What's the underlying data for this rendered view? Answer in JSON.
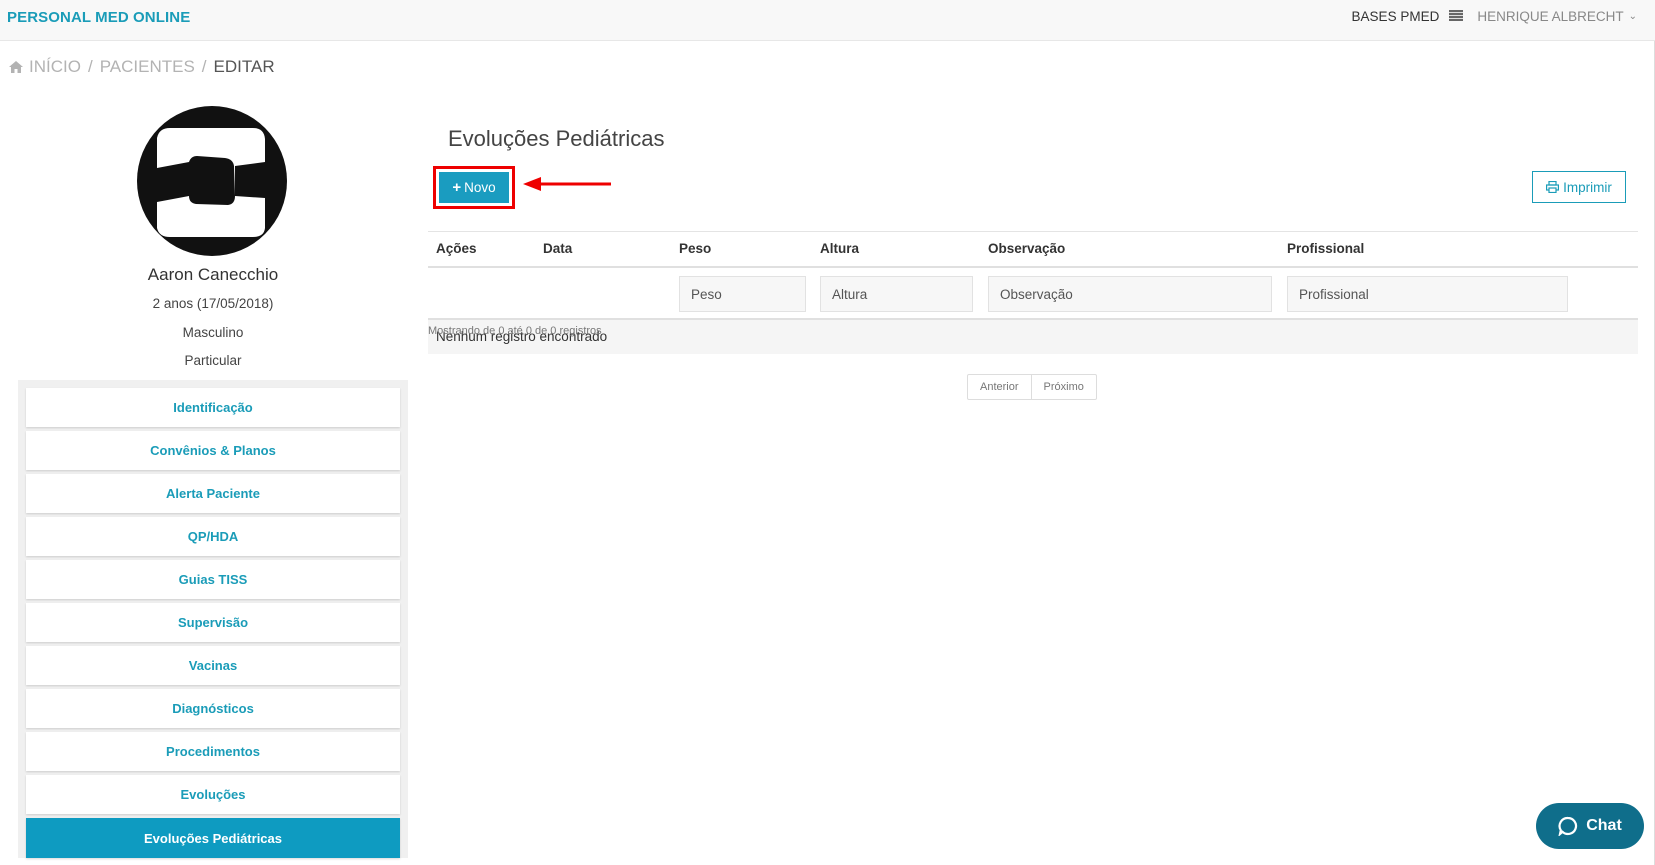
{
  "header": {
    "brand": "PERSONAL MED ONLINE",
    "bases": "BASES PMED",
    "user": "HENRIQUE ALBRECHT"
  },
  "breadcrumb": {
    "items": [
      "INÍCIO",
      "PACIENTES",
      "EDITAR"
    ]
  },
  "patient": {
    "name": "Aaron Canecchio",
    "age": "2 anos (17/05/2018)",
    "sex": "Masculino",
    "plan": "Particular"
  },
  "menu": {
    "items": [
      "Identificação",
      "Convênios & Planos",
      "Alerta Paciente",
      "QP/HDA",
      "Guias TISS",
      "Supervisão",
      "Vacinas",
      "Diagnósticos",
      "Procedimentos",
      "Evoluções",
      "Evoluções Pediátricas"
    ],
    "active_index": 10
  },
  "main": {
    "title": "Evoluções Pediátricas",
    "new_button": "Novo",
    "print_button": "Imprimir",
    "table": {
      "columns": [
        "Ações",
        "Data",
        "Peso",
        "Altura",
        "Observação",
        "Profissional"
      ],
      "filters": {
        "peso": "Peso",
        "altura": "Altura",
        "observacao": "Observação",
        "profissional": "Profissional"
      },
      "empty_message": "Nenhum registro encontrado"
    },
    "info": "Mostrando de 0 até 0 de 0 registros",
    "pagination": {
      "prev": "Anterior",
      "next": "Próximo"
    }
  },
  "chat": {
    "label": "Chat"
  },
  "colors": {
    "accent": "#1a9cb8",
    "active_menu": "#0e9bc1",
    "highlight": "#e00000",
    "chat": "#0f6e8b"
  }
}
